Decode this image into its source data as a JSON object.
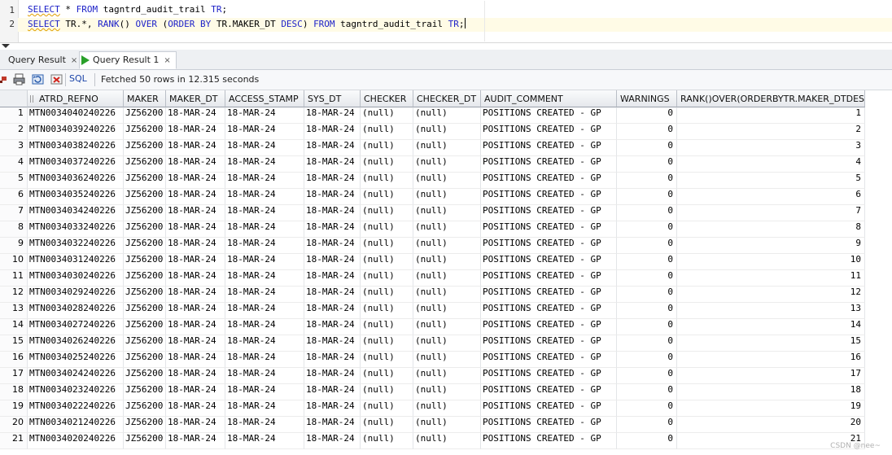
{
  "editor": {
    "line_numbers": [
      "1",
      "2"
    ],
    "line1": {
      "t1": "SELECT",
      "t2": " * ",
      "t3": "FROM",
      "t4": " tagntrd_audit_trail ",
      "t5": "TR",
      "t6": ";"
    },
    "line2": {
      "t1": "SELECT",
      "t2": " TR.*, ",
      "t3": "RANK",
      "t4": "() ",
      "t5": "OVER",
      "t6": " (",
      "t7": "ORDER BY",
      "t8": " TR.MAKER_DT ",
      "t9": "DESC",
      "t10": ") ",
      "t11": "FROM",
      "t12": " tagntrd_audit_trail ",
      "t13": "TR",
      "t14": ";"
    }
  },
  "tabs": [
    {
      "label": "Query Result",
      "close": "×",
      "active": false
    },
    {
      "label": "Query Result 1",
      "close": "×",
      "active": true
    }
  ],
  "toolbar": {
    "icons": [
      "pin-icon",
      "print-icon",
      "refresh-icon",
      "delete-icon"
    ],
    "sql_label": "SQL",
    "status": "Fetched 50 rows in 12.315 seconds"
  },
  "grid": {
    "columns": [
      "ATRD_REFNO",
      "MAKER",
      "MAKER_DT",
      "ACCESS_STAMP",
      "SYS_DT",
      "CHECKER",
      "CHECKER_DT",
      "AUDIT_COMMENT",
      "WARNINGS",
      "RANK()OVER(ORDERBYTR.MAKER_DTDESC)"
    ],
    "rows": [
      [
        "1",
        "MTN0034040240226",
        "JZ56200",
        "18-MAR-24",
        "18-MAR-24",
        "18-MAR-24",
        "(null)",
        "(null)",
        "POSITIONS CREATED - GP",
        "0",
        "1"
      ],
      [
        "2",
        "MTN0034039240226",
        "JZ56200",
        "18-MAR-24",
        "18-MAR-24",
        "18-MAR-24",
        "(null)",
        "(null)",
        "POSITIONS CREATED - GP",
        "0",
        "2"
      ],
      [
        "3",
        "MTN0034038240226",
        "JZ56200",
        "18-MAR-24",
        "18-MAR-24",
        "18-MAR-24",
        "(null)",
        "(null)",
        "POSITIONS CREATED - GP",
        "0",
        "3"
      ],
      [
        "4",
        "MTN0034037240226",
        "JZ56200",
        "18-MAR-24",
        "18-MAR-24",
        "18-MAR-24",
        "(null)",
        "(null)",
        "POSITIONS CREATED - GP",
        "0",
        "4"
      ],
      [
        "5",
        "MTN0034036240226",
        "JZ56200",
        "18-MAR-24",
        "18-MAR-24",
        "18-MAR-24",
        "(null)",
        "(null)",
        "POSITIONS CREATED - GP",
        "0",
        "5"
      ],
      [
        "6",
        "MTN0034035240226",
        "JZ56200",
        "18-MAR-24",
        "18-MAR-24",
        "18-MAR-24",
        "(null)",
        "(null)",
        "POSITIONS CREATED - GP",
        "0",
        "6"
      ],
      [
        "7",
        "MTN0034034240226",
        "JZ56200",
        "18-MAR-24",
        "18-MAR-24",
        "18-MAR-24",
        "(null)",
        "(null)",
        "POSITIONS CREATED - GP",
        "0",
        "7"
      ],
      [
        "8",
        "MTN0034033240226",
        "JZ56200",
        "18-MAR-24",
        "18-MAR-24",
        "18-MAR-24",
        "(null)",
        "(null)",
        "POSITIONS CREATED - GP",
        "0",
        "8"
      ],
      [
        "9",
        "MTN0034032240226",
        "JZ56200",
        "18-MAR-24",
        "18-MAR-24",
        "18-MAR-24",
        "(null)",
        "(null)",
        "POSITIONS CREATED - GP",
        "0",
        "9"
      ],
      [
        "10",
        "MTN0034031240226",
        "JZ56200",
        "18-MAR-24",
        "18-MAR-24",
        "18-MAR-24",
        "(null)",
        "(null)",
        "POSITIONS CREATED - GP",
        "0",
        "10"
      ],
      [
        "11",
        "MTN0034030240226",
        "JZ56200",
        "18-MAR-24",
        "18-MAR-24",
        "18-MAR-24",
        "(null)",
        "(null)",
        "POSITIONS CREATED - GP",
        "0",
        "11"
      ],
      [
        "12",
        "MTN0034029240226",
        "JZ56200",
        "18-MAR-24",
        "18-MAR-24",
        "18-MAR-24",
        "(null)",
        "(null)",
        "POSITIONS CREATED - GP",
        "0",
        "12"
      ],
      [
        "13",
        "MTN0034028240226",
        "JZ56200",
        "18-MAR-24",
        "18-MAR-24",
        "18-MAR-24",
        "(null)",
        "(null)",
        "POSITIONS CREATED - GP",
        "0",
        "13"
      ],
      [
        "14",
        "MTN0034027240226",
        "JZ56200",
        "18-MAR-24",
        "18-MAR-24",
        "18-MAR-24",
        "(null)",
        "(null)",
        "POSITIONS CREATED - GP",
        "0",
        "14"
      ],
      [
        "15",
        "MTN0034026240226",
        "JZ56200",
        "18-MAR-24",
        "18-MAR-24",
        "18-MAR-24",
        "(null)",
        "(null)",
        "POSITIONS CREATED - GP",
        "0",
        "15"
      ],
      [
        "16",
        "MTN0034025240226",
        "JZ56200",
        "18-MAR-24",
        "18-MAR-24",
        "18-MAR-24",
        "(null)",
        "(null)",
        "POSITIONS CREATED - GP",
        "0",
        "16"
      ],
      [
        "17",
        "MTN0034024240226",
        "JZ56200",
        "18-MAR-24",
        "18-MAR-24",
        "18-MAR-24",
        "(null)",
        "(null)",
        "POSITIONS CREATED - GP",
        "0",
        "17"
      ],
      [
        "18",
        "MTN0034023240226",
        "JZ56200",
        "18-MAR-24",
        "18-MAR-24",
        "18-MAR-24",
        "(null)",
        "(null)",
        "POSITIONS CREATED - GP",
        "0",
        "18"
      ],
      [
        "19",
        "MTN0034022240226",
        "JZ56200",
        "18-MAR-24",
        "18-MAR-24",
        "18-MAR-24",
        "(null)",
        "(null)",
        "POSITIONS CREATED - GP",
        "0",
        "19"
      ],
      [
        "20",
        "MTN0034021240226",
        "JZ56200",
        "18-MAR-24",
        "18-MAR-24",
        "18-MAR-24",
        "(null)",
        "(null)",
        "POSITIONS CREATED - GP",
        "0",
        "20"
      ],
      [
        "21",
        "MTN0034020240226",
        "JZ56200",
        "18-MAR-24",
        "18-MAR-24",
        "18-MAR-24",
        "(null)",
        "(null)",
        "POSITIONS CREATED - GP",
        "0",
        "21"
      ]
    ]
  },
  "watermark": "CSDN @nee~"
}
